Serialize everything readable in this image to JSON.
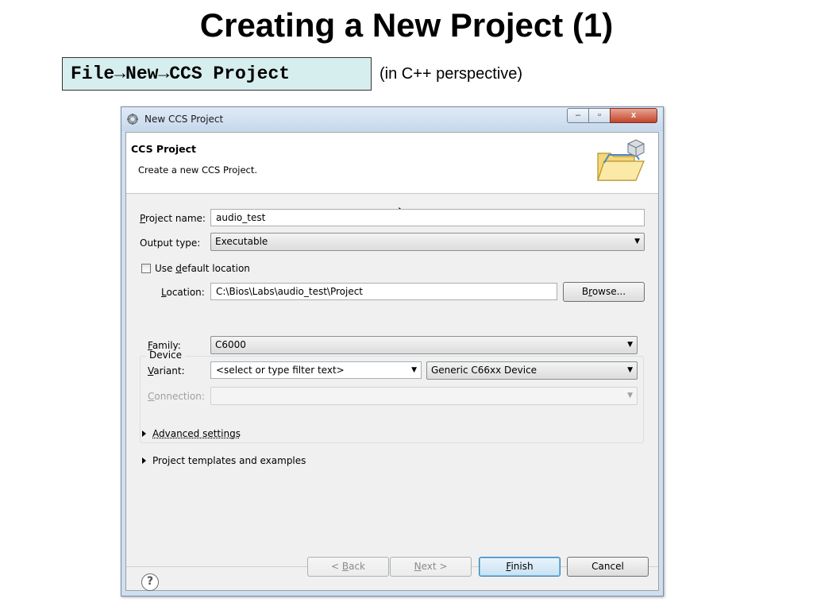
{
  "slide": {
    "title": "Creating a New Project (1)",
    "menu_path": "File→New→CCS Project",
    "note": "(in C++ perspective)"
  },
  "window": {
    "title": "New CCS Project",
    "controls": {
      "minimize": "–",
      "maximize": "▫",
      "close": "x"
    }
  },
  "banner": {
    "title": "CCS Project",
    "description": "Create a new CCS Project."
  },
  "form": {
    "project_name_label_u": "P",
    "project_name_label_rest": "roject name:",
    "project_name_value": "audio_test",
    "output_type_label": "Output type:",
    "output_type_value": "Executable",
    "use_default_location_pre": "Use ",
    "use_default_location_u": "d",
    "use_default_location_post": "efault location",
    "use_default_location_checked": false,
    "location_label_u": "L",
    "location_label_rest": "ocation:",
    "location_value": "C:\\Bios\\Labs\\audio_test\\Project",
    "browse_pre": "B",
    "browse_u": "r",
    "browse_post": "owse..."
  },
  "device": {
    "group_label": "Device",
    "family_label_u": "F",
    "family_label_rest": "amily:",
    "family_value": "C6000",
    "variant_label_u": "V",
    "variant_label_rest": "ariant:",
    "variant_filter_placeholder": "<select or type filter text>",
    "variant_value": "Generic C66xx Device",
    "connection_label_u": "C",
    "connection_label_rest": "onnection:",
    "connection_value": ""
  },
  "sections": {
    "advanced_settings": "Advanced settings",
    "project_templates": "Project templates and examples"
  },
  "buttons": {
    "back_pre": "< ",
    "back_u": "B",
    "back_post": "ack",
    "next_u": "N",
    "next_post": "ext >",
    "finish_u": "F",
    "finish_post": "inish",
    "cancel": "Cancel",
    "help": "?"
  },
  "colors": {
    "path_box_bg": "#d7eeee",
    "titlebar": "#cfdff0",
    "close_button": "#c3452b",
    "dialog_bg": "#f0f0f0"
  },
  "icons": [
    "gear-window-icon",
    "folder-project-icon",
    "mouse-cursor-icon",
    "help-icon",
    "expand-triangle-icon",
    "dropdown-arrow-icon"
  ]
}
